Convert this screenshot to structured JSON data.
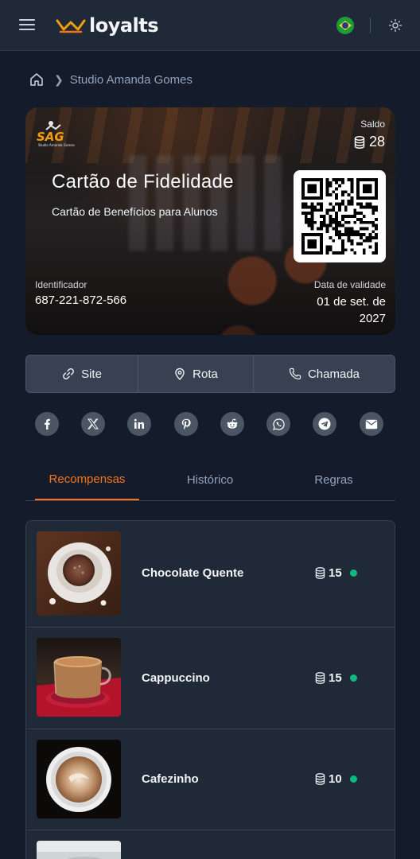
{
  "header": {
    "brand": "loyalts",
    "logo_icon": "crown-icon",
    "language_flag": "brazil-flag",
    "theme_icon": "sun-icon"
  },
  "breadcrumb": {
    "home_icon": "home-icon",
    "current": "Studio Amanda Gomes"
  },
  "card": {
    "logo_text": "SAG",
    "logo_subtext": "Studio Amanda Gomes",
    "balance_label": "Saldo",
    "balance_value": "28",
    "title": "Cartão de Fidelidade",
    "subtitle": "Cartão de Benefícios para Alunos",
    "identifier_label": "Identificador",
    "identifier_value": "687-221-872-566",
    "expiry_label": "Data de validade",
    "expiry_value": "01 de set. de 2027"
  },
  "actions": [
    {
      "label": "Site",
      "icon": "link-icon"
    },
    {
      "label": "Rota",
      "icon": "map-pin-icon"
    },
    {
      "label": "Chamada",
      "icon": "phone-icon"
    }
  ],
  "social": [
    "facebook",
    "x",
    "linkedin",
    "pinterest",
    "reddit",
    "whatsapp",
    "telegram",
    "email"
  ],
  "tabs": [
    {
      "label": "Recompensas",
      "active": true
    },
    {
      "label": "Histórico",
      "active": false
    },
    {
      "label": "Regras",
      "active": false
    }
  ],
  "rewards": [
    {
      "name": "Chocolate Quente",
      "cost": "15",
      "available": true
    },
    {
      "name": "Cappuccino",
      "cost": "15",
      "available": true
    },
    {
      "name": "Cafezinho",
      "cost": "10",
      "available": true
    }
  ],
  "colors": {
    "accent": "#f97316",
    "background": "#141c2b",
    "surface": "#1f2937",
    "available": "#10b981"
  }
}
